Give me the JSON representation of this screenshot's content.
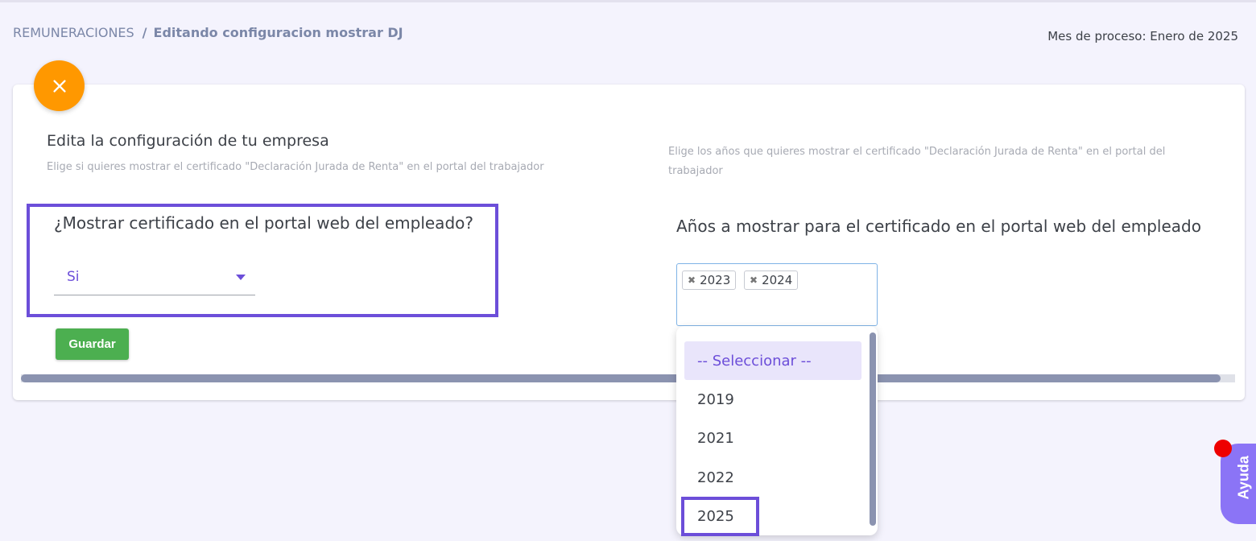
{
  "breadcrumb": {
    "root": "REMUNERACIONES",
    "separator": "/",
    "current": "Editando configuracion mostrar DJ"
  },
  "process_month": "Mes de proceso: Enero de 2025",
  "left": {
    "title": "Edita la configuración de tu empresa",
    "subtitle": "Elige si quieres mostrar el certificado \"Declaración Jurada de Renta\" en el portal del trabajador",
    "question": "¿Mostrar certificado en el portal web del empleado?",
    "select_value": "Si",
    "save_label": "Guardar"
  },
  "right": {
    "subtitle": "Elige los años que quieres mostrar el certificado \"Declaración Jurada de Renta\" en el portal del trabajador",
    "label": "Años a mostrar para el certificado en el portal web del empleado",
    "selected_tags": [
      "2023",
      "2024"
    ],
    "tag_remove_glyph": "✖",
    "dropdown_options": [
      "-- Seleccionar --",
      "2019",
      "2021",
      "2022",
      "2025"
    ]
  },
  "help_label": "Ayuda",
  "colors": {
    "accent": "#6c4ed9",
    "close_fab": "#ff9800",
    "save_button": "#4caf50",
    "help_button": "#8b74f6",
    "notification_dot": "#ee0000"
  },
  "icons": {
    "close": "close-icon",
    "caret": "caret-down-icon",
    "tag_remove": "x-icon"
  }
}
